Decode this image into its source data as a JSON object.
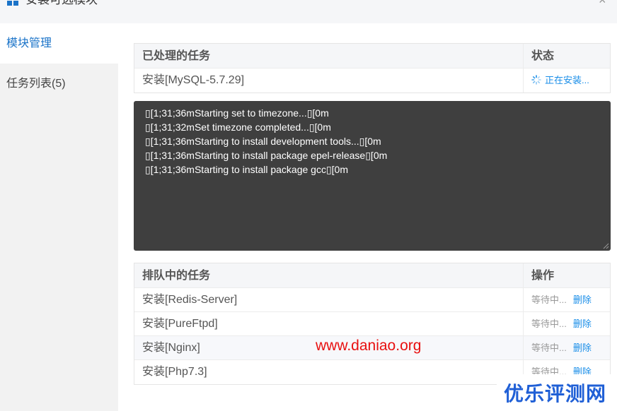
{
  "window": {
    "title": "安装可选模块",
    "close_glyph": "×",
    "icon": "grid-icon"
  },
  "sidebar": {
    "items": [
      {
        "label": "模块管理",
        "active": true
      },
      {
        "label": "任务列表(5)",
        "active": false
      }
    ]
  },
  "processed": {
    "headers": [
      "已处理的任务",
      "状态"
    ],
    "rows": [
      {
        "task": "安装[MySQL-5.7.29]",
        "status": "正在安装..."
      }
    ]
  },
  "console": {
    "lines": [
      "\u0000[1;31;36mStarting set to timezone...\u0000[0m",
      "\u0000[1;31;32mSet timezone completed...\u0000[0m",
      "\u0000[1;31;36mStarting to install development tools...\u0000[0m",
      "\u0000[1;31;36mStarting to install package epel-release\u0000[0m",
      "\u0000[1;31;36mStarting to install package gcc\u0000[0m"
    ]
  },
  "queue": {
    "headers": [
      "排队中的任务",
      "操作"
    ],
    "rows": [
      {
        "task": "安装[Redis-Server]",
        "status": "等待中...",
        "action": "删除"
      },
      {
        "task": "安装[PureFtpd]",
        "status": "等待中...",
        "action": "删除"
      },
      {
        "task": "安装[Nginx]",
        "status": "等待中...",
        "action": "删除"
      },
      {
        "task": "安装[Php7.3]",
        "status": "等待中...",
        "action": "删除"
      }
    ]
  },
  "overlays": {
    "watermark": "www.daniao.org",
    "corner_badge": "优乐评测网"
  },
  "colors": {
    "accent": "#1a8ee8",
    "sidebar_active_text": "#1a73c8",
    "console_bg": "#3f3f3f",
    "watermark": "#e81010",
    "badge": "#1f5fd6"
  }
}
